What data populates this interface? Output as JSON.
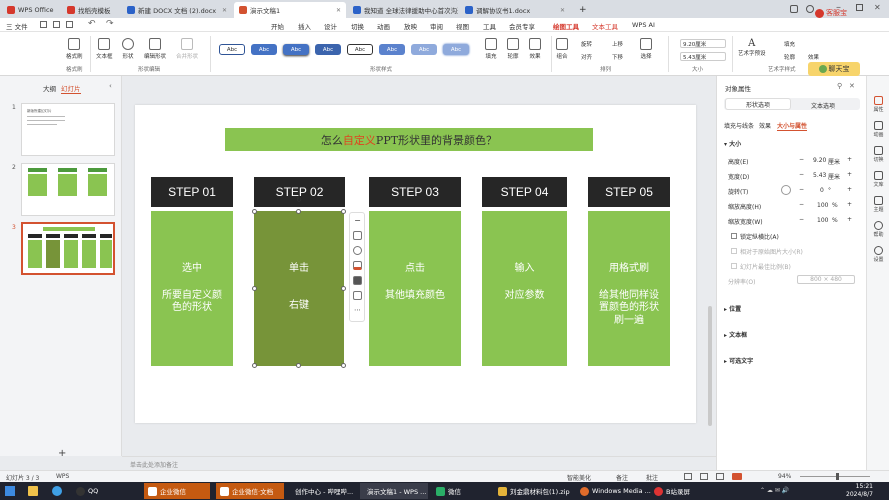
{
  "titlebar": {
    "tabs": [
      {
        "label": "WPS Office",
        "color": "#d5382c"
      },
      {
        "label": "找稻壳模板",
        "color": "#d5382c"
      },
      {
        "label": "新建 DOCX 文档 (2).docx",
        "color": "#2b62c8"
      },
      {
        "label": "演示文稿1",
        "color": "#d35230",
        "active": true
      },
      {
        "label": "我知道 全球法律援助中心首次沟通",
        "color": "#2b62c8"
      },
      {
        "label": "调解协议书1.docx",
        "color": "#2b62c8"
      }
    ],
    "new_tab": "+",
    "user_label": "客服宝"
  },
  "menubar": {
    "file": "三 文件",
    "items": [
      "开始",
      "插入",
      "设计",
      "切换",
      "动画",
      "放映",
      "审阅",
      "视图",
      "工具",
      "会员专享",
      "绘图工具",
      "文本工具",
      "WPS AI"
    ],
    "selected": "绘图工具"
  },
  "ribbon": {
    "buttons": [
      "格式刷",
      "文本框",
      "形状",
      "编辑形状",
      "合并形状"
    ],
    "groups": [
      "格式刷",
      "形状编辑",
      "形状样式",
      "排列",
      "大小",
      "艺术字样式"
    ],
    "style_label": "Abc",
    "fill": "填充",
    "outline": "轮廓",
    "effect": "效果",
    "group": "组合",
    "rotate": "旋转",
    "align": "对齐",
    "up": "上移",
    "down": "下移",
    "select": "选择",
    "height": "9.20厘米",
    "width": "5.43厘米",
    "wordart": "艺术字预设",
    "text_fill": "填充",
    "text_outline": "轮廓",
    "text_effect": "效果",
    "chat_label": "聊天宝"
  },
  "leftpane": {
    "tab_outline": "大纲",
    "tab_slides": "幻灯片",
    "slide_numbers": [
      "1",
      "2",
      "3"
    ],
    "thumb1_title": "新版所建幻灯片",
    "add": "+"
  },
  "slide": {
    "title_a": "怎么",
    "title_b": "自定义",
    "title_c": "PPT形状里的背景颜色？",
    "steps": [
      {
        "header": "STEP 01",
        "line1": "选中",
        "line2": "所要自定义颜色的形状"
      },
      {
        "header": "STEP 02",
        "line1": "单击",
        "line2": "右键"
      },
      {
        "header": "STEP 03",
        "line1": "点击",
        "line2": "其他填充颜色"
      },
      {
        "header": "STEP 04",
        "line1": "输入",
        "line2": "对应参数"
      },
      {
        "header": "STEP 05",
        "line1": "用格式刷",
        "line2": "给其他同样设置颜色的形状刷一遍"
      }
    ]
  },
  "notes": {
    "placeholder": "单击此处添加备注"
  },
  "rightpanel": {
    "title": "对象属性",
    "tab_shape": "形状选项",
    "tab_text": "文本选项",
    "sub_fill": "填充与线条",
    "sub_effect": "效果",
    "sub_size": "大小与属性",
    "section_size": "大小",
    "height_label": "高度(E)",
    "height_value": "9.20",
    "width_label": "宽度(D)",
    "width_value": "5.43",
    "rotate_label": "旋转(T)",
    "rotate_value": "0",
    "scale_h_label": "缩放高度(H)",
    "scale_h_value": "100",
    "scale_w_label": "缩放宽度(W)",
    "scale_w_value": "100",
    "lock_ratio": "锁定纵横比(A)",
    "relative": "相对于原始图片大小(R)",
    "best_scale": "幻灯片最佳比例(B)",
    "resolution_label": "分辨率(O)",
    "resolution_value": "800 × 480",
    "unit_cm": "厘米",
    "unit_deg": "°",
    "unit_pct": "%",
    "minus": "−",
    "plus": "+",
    "section_position": "位置",
    "section_textbox": "文本框",
    "section_alt": "可选文字"
  },
  "rightside": [
    "属性",
    "动画",
    "切换",
    "文库",
    "主题",
    "帮助",
    "设置"
  ],
  "status": {
    "slide_info": "幻灯片 3 / 3",
    "app": "WPS",
    "beautify": "智能美化",
    "notes_btn": "备注",
    "comment_btn": "批注",
    "zoom": "94%"
  },
  "taskbar": {
    "items": [
      "QQ",
      "企业微信",
      "企业微信·文档",
      "创作中心 - 哔哩哔...",
      "演示文稿1 - WPS ...",
      "微信",
      "刘金鼎材料包(1).zip",
      "Windows Media ...",
      "B站录屏"
    ],
    "time": "15:21",
    "date": "2024/8/7"
  }
}
